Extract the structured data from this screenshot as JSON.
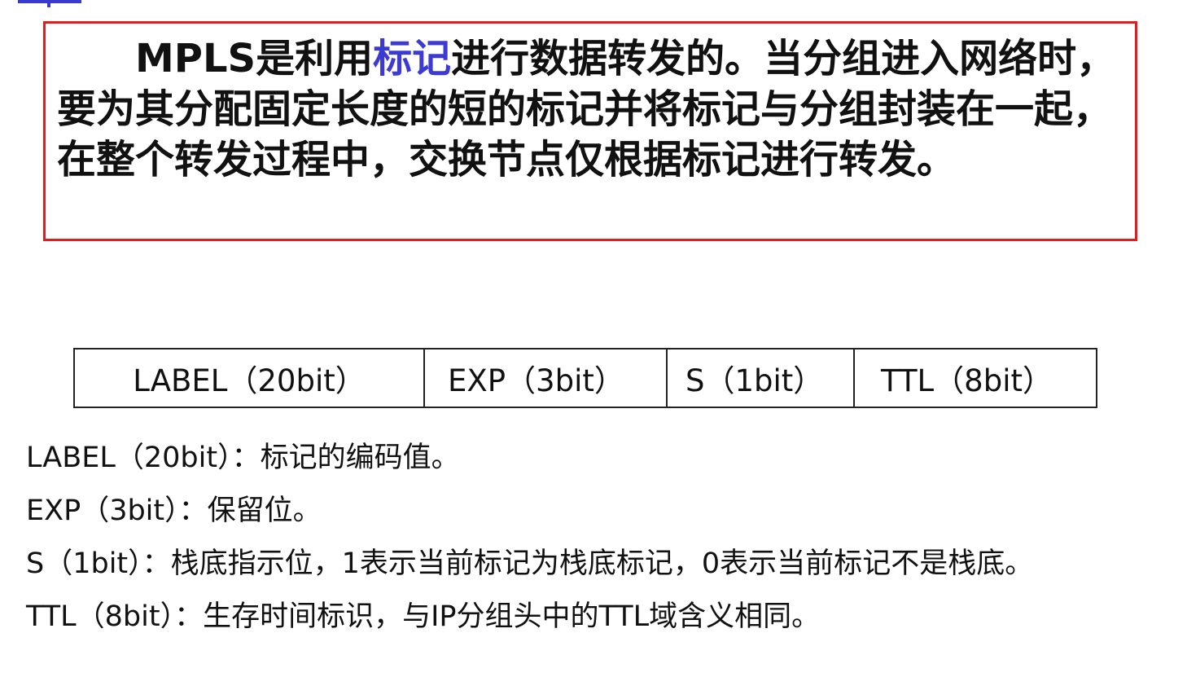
{
  "definition": {
    "before": "MPLS是利用",
    "highlight": "标记",
    "after": "进行数据转发的。当分组进入网络时，要为其分配固定长度的短的标记并将标记与分组封装在一起，在整个转发过程中，交换节点仅根据标记进行转发。",
    "highlight_color": "#3b3bd4",
    "border_color": "#e11d1d"
  },
  "header_fields": [
    {
      "label": "LABEL（20bit）"
    },
    {
      "label": "EXP（3bit）"
    },
    {
      "label": "S（1bit）"
    },
    {
      "label": "TTL（8bit）"
    }
  ],
  "explanations": [
    "LABEL（20bit）：标记的编码值。",
    "EXP（3bit）：保留位。",
    "S（1bit）：栈底指示位，1表示当前标记为栈底标记，0表示当前标记不是栈底。",
    "TTL（8bit）：生存时间标识，与IP分组头中的TTL域含义相同。"
  ]
}
